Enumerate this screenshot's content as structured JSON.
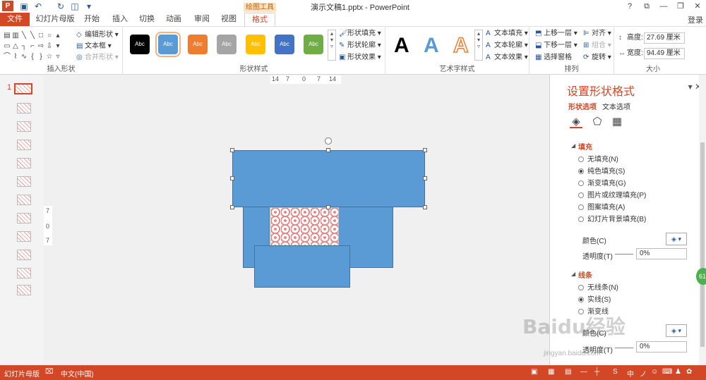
{
  "window": {
    "title": "演示文稿1.pptx - PowerPoint",
    "logo": "P",
    "controls": [
      "?",
      "⧉",
      "—",
      "❐",
      "✕"
    ],
    "login": "登录"
  },
  "quick_access": [
    "save-icon",
    "undo-icon",
    "redo-icon",
    "slideshow-icon",
    "customize-icon"
  ],
  "contextual_tab": "绘图工具",
  "tabs": [
    {
      "label": "文件"
    },
    {
      "label": "幻灯片母版"
    },
    {
      "label": "开始"
    },
    {
      "label": "插入"
    },
    {
      "label": "切换"
    },
    {
      "label": "动画"
    },
    {
      "label": "审阅"
    },
    {
      "label": "视图"
    },
    {
      "label": "格式"
    }
  ],
  "ribbon": {
    "insert_shapes": {
      "label": "插入形状",
      "edit_shape": "编辑形状",
      "text_box": "文本框",
      "merge_shapes": "合并形状"
    },
    "shape_styles": {
      "label": "形状样式",
      "presets": [
        {
          "text": "Abc",
          "color": "#000000"
        },
        {
          "text": "Abc",
          "color": "#5b9bd5"
        },
        {
          "text": "Abc",
          "color": "#ed7d31"
        },
        {
          "text": "Abc",
          "color": "#a5a5a5"
        },
        {
          "text": "Abc",
          "color": "#ffc000"
        },
        {
          "text": "Abc",
          "color": "#4472c4"
        },
        {
          "text": "Abc",
          "color": "#70ad47"
        }
      ],
      "fill": "形状填充",
      "outline": "形状轮廓",
      "effects": "形状效果"
    },
    "wordart": {
      "label": "艺术字样式",
      "samples": [
        "A",
        "A",
        "A"
      ],
      "text_fill": "文本填充",
      "text_outline": "文本轮廓",
      "text_effects": "文本效果"
    },
    "arrange": {
      "label": "排列",
      "bring_forward": "上移一层",
      "send_backward": "下移一层",
      "selection_pane": "选择窗格",
      "align": "对齐",
      "group": "组合",
      "rotate": "旋转"
    },
    "size": {
      "label": "大小",
      "height_label": "高度:",
      "height_value": "27.69 厘米",
      "width_label": "宽度:",
      "width_value": "94.49 厘米"
    }
  },
  "ruler": {
    "h_ticks": [
      "14",
      "7",
      "0",
      "7",
      "14"
    ],
    "v_ticks": [
      "7",
      "0",
      "7"
    ]
  },
  "thumbnails": {
    "active_index": "1",
    "count": 12
  },
  "format_pane": {
    "title": "设置形状格式",
    "tabs": [
      "形状选项",
      "文本选项"
    ],
    "icons": [
      "fill-line-icon",
      "effects-icon",
      "size-properties-icon"
    ],
    "fill_section": "填充",
    "fill_options": [
      {
        "label": "无填充(N)",
        "selected": false
      },
      {
        "label": "纯色填充(S)",
        "selected": true
      },
      {
        "label": "渐变填充(G)",
        "selected": false
      },
      {
        "label": "图片或纹理填充(P)",
        "selected": false
      },
      {
        "label": "图案填充(A)",
        "selected": false
      },
      {
        "label": "幻灯片背景填充(B)",
        "selected": false
      }
    ],
    "color_label": "颜色(C)",
    "transparency_label": "透明度(T)",
    "transparency_value": "0%",
    "line_section": "线条",
    "line_options": [
      {
        "label": "无线条(N)",
        "selected": false
      },
      {
        "label": "实线(S)",
        "selected": true
      },
      {
        "label": "渐变线",
        "selected": false
      }
    ],
    "line_color_label": "颜色(C)",
    "line_transparency_label": "透明度(T)",
    "line_transparency_value": "0%"
  },
  "status_bar": {
    "view": "幻灯片母版",
    "language": "中文(中国)"
  },
  "watermark": {
    "main": "Baidu经验",
    "sub": "jingyan.baidu.com"
  },
  "badge": "61",
  "colors": {
    "accent": "#d24726",
    "shape_fill": "#5b9bd5",
    "shape_outline": "#41719c"
  }
}
